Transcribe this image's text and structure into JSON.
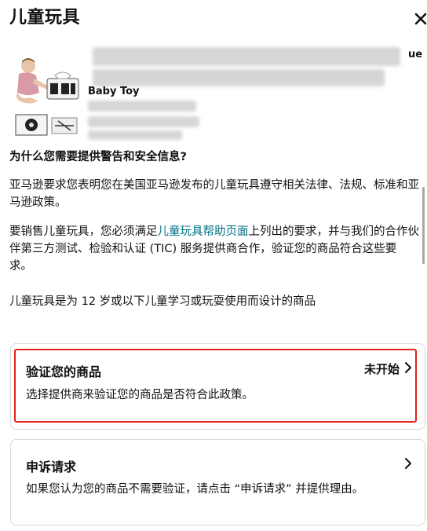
{
  "header": {
    "title": "儿童玩具"
  },
  "product": {
    "name": "Baby Toy",
    "title_end": "ue"
  },
  "info": {
    "question": "为什么您需要提供警告和安全信息?",
    "para1": "亚马逊要求您表明您在美国亚马逊发布的儿童玩具遵守相关法律、法规、标准和亚马逊政策。",
    "para2_before": "要销售儿童玩具，您必须满足",
    "para2_link": "儿童玩具帮助页面",
    "para2_after": "上列出的要求，并与我们的合作伙伴第三方测试、检验和认证 (TIC) 服务提供商合作，验证您的商品符合这些要求。",
    "para3": "儿童玩具是为 12 岁或以下儿童学习或玩耍使用而设计的商品"
  },
  "cards": {
    "verify": {
      "title": "验证您的商品",
      "status": "未开始",
      "desc": "选择提供商来验证您的商品是否符合此政策。"
    },
    "appeal": {
      "title": "申诉请求",
      "desc": "如果您认为您的商品不需要验证，请点击 “申诉请求” 并提供理由。"
    }
  },
  "colors": {
    "link": "#007185",
    "highlight_border": "#e3241d",
    "card_border": "#d5d9d9",
    "text": "#0f1111"
  },
  "icons": {
    "close": "close-icon",
    "chevron": "chevron-right-icon"
  }
}
